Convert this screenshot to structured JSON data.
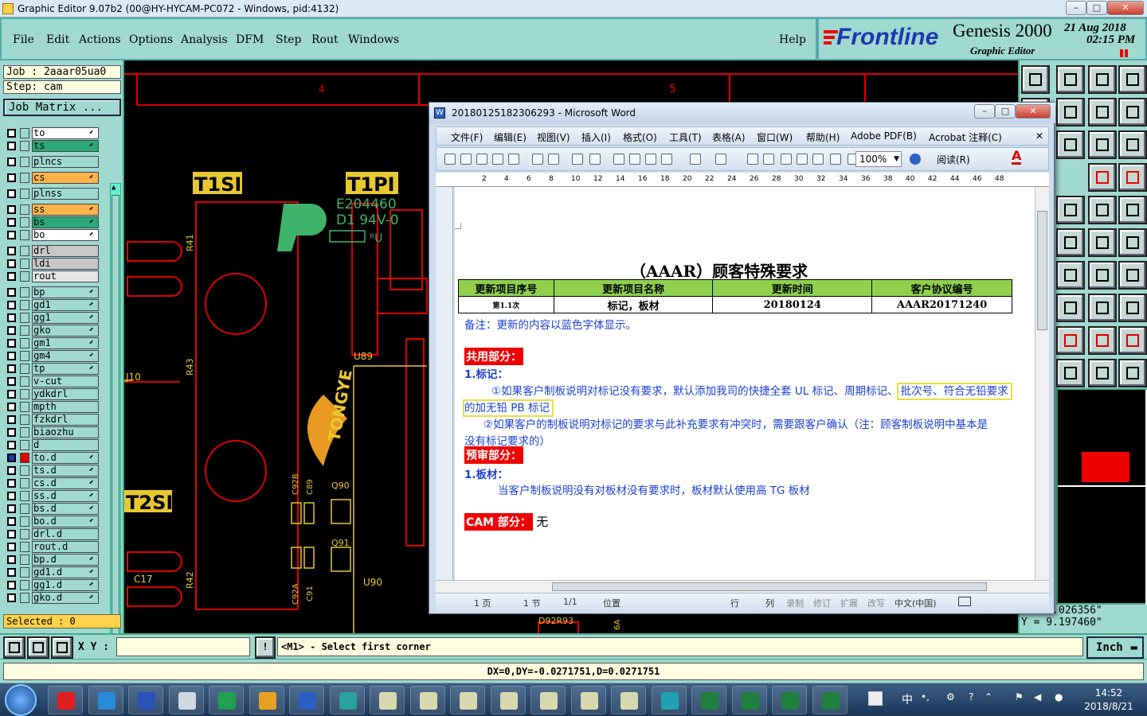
{
  "window": {
    "title": "Graphic Editor 9.07b2 (00@HY-HYCAM-PC072 - Windows, pid:4132)",
    "min": "–",
    "max": "□",
    "close": "✕"
  },
  "menu": {
    "items": [
      "File",
      "Edit",
      "Actions",
      "Options",
      "Analysis",
      "DFM",
      "Step",
      "Rout",
      "Windows"
    ],
    "help": "Help"
  },
  "brand": {
    "logo": "Frontline",
    "product": "Genesis 2000",
    "subtitle": "Graphic Editor",
    "date": "21 Aug 2018",
    "time": "02:15 PM"
  },
  "job": {
    "job_line": "Job : 2aaar05ua0",
    "step_line": "Step: cam",
    "matrix_button": "Job Matrix ..."
  },
  "layers": [
    {
      "name": "to",
      "bg": "#ffffff",
      "arrow": true
    },
    {
      "name": "ts",
      "bg": "#2aa876",
      "arrow": true
    },
    {
      "name": "plncs",
      "bg": "#9fd9cf",
      "arrow": false
    },
    {
      "name": "cs",
      "bg": "#ffb347",
      "arrow": true
    },
    {
      "name": "plnss",
      "bg": "#9fd9cf",
      "arrow": false
    },
    {
      "name": "ss",
      "bg": "#ffb347",
      "arrow": true
    },
    {
      "name": "bs",
      "bg": "#2aa876",
      "arrow": true
    },
    {
      "name": "bo",
      "bg": "#ffffff",
      "arrow": true
    },
    {
      "name": "drl",
      "bg": "#c8c8c8",
      "arrow": false
    },
    {
      "name": "ldi",
      "bg": "#c8c8c8",
      "arrow": false
    },
    {
      "name": "rout",
      "bg": "#e6e6e6",
      "arrow": false
    },
    {
      "name": "bp",
      "bg": "#9fd9cf",
      "arrow": true
    },
    {
      "name": "gd1",
      "bg": "#9fd9cf",
      "arrow": true
    },
    {
      "name": "gg1",
      "bg": "#9fd9cf",
      "arrow": true
    },
    {
      "name": "gko",
      "bg": "#9fd9cf",
      "arrow": true
    },
    {
      "name": "gm1",
      "bg": "#9fd9cf",
      "arrow": true
    },
    {
      "name": "gm4",
      "bg": "#9fd9cf",
      "arrow": true
    },
    {
      "name": "tp",
      "bg": "#9fd9cf",
      "arrow": true
    },
    {
      "name": "v-cut",
      "bg": "#9fd9cf",
      "arrow": false
    },
    {
      "name": "ydkdrl",
      "bg": "#9fd9cf",
      "arrow": false
    },
    {
      "name": "mpth",
      "bg": "#9fd9cf",
      "arrow": false
    },
    {
      "name": "fzkdrl",
      "bg": "#9fd9cf",
      "arrow": false
    },
    {
      "name": "biaozhu",
      "bg": "#9fd9cf",
      "arrow": false
    },
    {
      "name": "d",
      "bg": "#9fd9cf",
      "arrow": false
    },
    {
      "name": "to.d",
      "bg": "#9fd9cf",
      "arrow": true,
      "active": true
    },
    {
      "name": "ts.d",
      "bg": "#9fd9cf",
      "arrow": true
    },
    {
      "name": "cs.d",
      "bg": "#9fd9cf",
      "arrow": true
    },
    {
      "name": "ss.d",
      "bg": "#9fd9cf",
      "arrow": true
    },
    {
      "name": "bs.d",
      "bg": "#9fd9cf",
      "arrow": true
    },
    {
      "name": "bo.d",
      "bg": "#9fd9cf",
      "arrow": true
    },
    {
      "name": "drl.d",
      "bg": "#9fd9cf",
      "arrow": false
    },
    {
      "name": "rout.d",
      "bg": "#9fd9cf",
      "arrow": false
    },
    {
      "name": "bp.d",
      "bg": "#9fd9cf",
      "arrow": true
    },
    {
      "name": "gd1.d",
      "bg": "#9fd9cf",
      "arrow": true
    },
    {
      "name": "gg1.d",
      "bg": "#9fd9cf",
      "arrow": true
    },
    {
      "name": "gko.d",
      "bg": "#9fd9cf",
      "arrow": true
    }
  ],
  "selected": "Selected : 0",
  "canvas": {
    "labels": {
      "t1si": "T1SI",
      "t1pi": "T1PI",
      "t2si": "T2SI",
      "e_code": "E204460",
      "d1": "D1  94V-0",
      "r41": "R41",
      "r43": "R43",
      "r42": "R42",
      "u89": "U89",
      "j10": "J10",
      "c17": "C17",
      "u90": "U90",
      "q90": "Q90",
      "q91": "Q91",
      "c92b": "C92B",
      "c89": "C89",
      "c92a": "C92A",
      "c91": "C91",
      "d92": "D92R93",
      "n4": "4",
      "n5": "5",
      "tongye": "TONGYE",
      "sixa": "6A"
    }
  },
  "coords": {
    "x": "X = 4.026356\"",
    "y": "Y = 9.197460\""
  },
  "cmd": {
    "xy_label": "X Y :",
    "prompt": "<M1> - Select first corner",
    "units": "Inch",
    "bang": "!"
  },
  "status": "DX=0,DY=-0.0271751,D=0.0271751",
  "word": {
    "title": "20180125182306293 - Microsoft Word",
    "menu": [
      "文件(F)",
      "编辑(E)",
      "视图(V)",
      "插入(I)",
      "格式(O)",
      "工具(T)",
      "表格(A)",
      "窗口(W)",
      "帮助(H)",
      "Adobe PDF(B)",
      "Acrobat 注释(C)"
    ],
    "zoom": "100%",
    "read_btn": "阅读(R)",
    "ruler_ticks": [
      "2",
      "4",
      "6",
      "8",
      "10",
      "12",
      "14",
      "16",
      "18",
      "20",
      "22",
      "24",
      "26",
      "28",
      "30",
      "32",
      "34",
      "36",
      "38",
      "40",
      "42",
      "44",
      "46",
      "48"
    ],
    "doc": {
      "heading": "（AAAR）顾客特殊要求",
      "table_header": [
        "更新项目序号",
        "更新项目名称",
        "更新时间",
        "客户协议编号"
      ],
      "table_row": [
        "第1.1次",
        "标记，板材",
        "20180124",
        "AAAR20171240"
      ],
      "note": "备注：更新的内容以蓝色字体显示。",
      "common": "共用部分：",
      "s1": "1.标记：",
      "p1a": "①如果客户制板说明对标记没有要求，默认添加我司的快捷全套 UL 标记、周期标记、",
      "p1b": "批次号、符合无铅要求",
      "p1c": "的加无铅 PB 标记",
      "p2a": "②如果客户的制板说明对标记的要求与此补充要求有冲突时，需要跟客户确认（注：顾客制板说明中基本是",
      "p2b": "没有标记要求的）",
      "review": "预审部分：",
      "s2": "1.板材：",
      "p3": "当客户制板说明没有对板材没有要求时，板材默认使用高 TG 板材",
      "cam": "CAM 部分：",
      "cam_val": "无"
    },
    "status": {
      "page": "1 页",
      "section": "1 节",
      "pos": "1/1",
      "at": "位置",
      "row": "行",
      "col": "列",
      "rec": "录制",
      "rev": "修订",
      "ext": "扩展",
      "ovr": "改写",
      "lang": "中文(中国)"
    }
  },
  "taskbar": {
    "ime": "中",
    "time": "14:52",
    "date": "2018/8/21"
  },
  "colors": {
    "teal": "#9fd9cf",
    "pcb_red": "#e00000",
    "pcb_yellow": "#e8c832",
    "pcb_green": "#3fb36a",
    "word_green": "#8fd14f"
  }
}
